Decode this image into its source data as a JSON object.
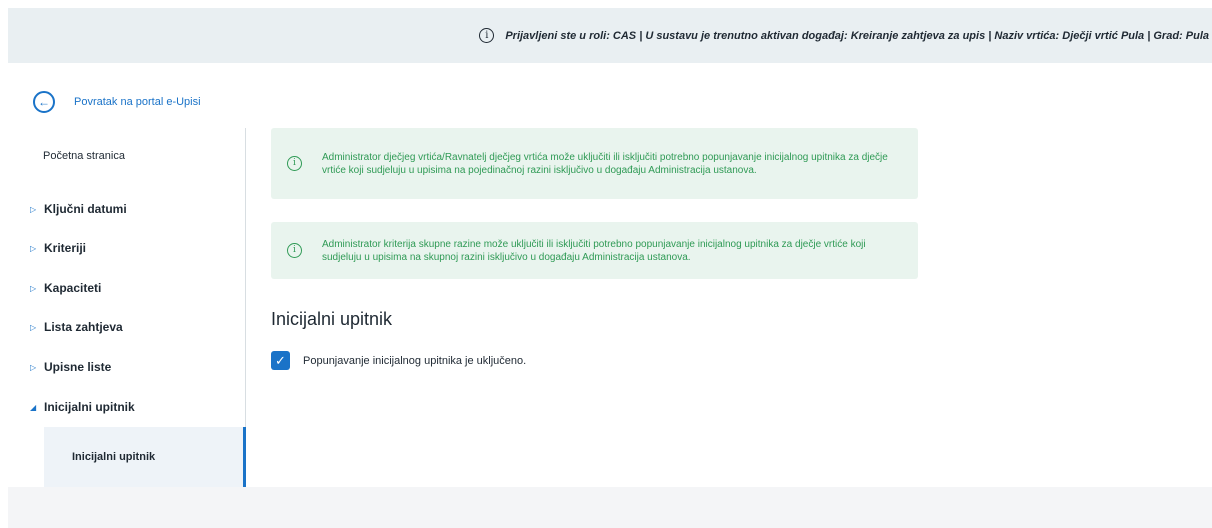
{
  "header": {
    "status_text": "Prijavljeni ste u roli: CAS | U sustavu je trenutno aktivan događaj: Kreiranje zahtjeva za upis | Naziv vrtića: Dječji vrtić Pula | Grad: Pula",
    "info_icon": "info-icon"
  },
  "back_link": {
    "label": "Povratak na portal e-Upisi",
    "icon": "arrow-left-icon"
  },
  "sidebar": {
    "home": "Početna stranica",
    "items": [
      {
        "label": "Ključni datumi",
        "expanded": false
      },
      {
        "label": "Kriteriji",
        "expanded": false
      },
      {
        "label": "Kapaciteti",
        "expanded": false
      },
      {
        "label": "Lista zahtjeva",
        "expanded": false
      },
      {
        "label": "Upisne liste",
        "expanded": false
      },
      {
        "label": "Inicijalni upitnik",
        "expanded": true
      }
    ],
    "sub_item": "Inicijalni upitnik"
  },
  "notices": [
    {
      "text": "Administrator dječjeg vrtića/Ravnatelj dječjeg vrtića može uključiti ili isključiti potrebno popunjavanje inicijalnog upitnika za dječje vrtiće koji sudjeluju u upisima na pojedinačnoj razini isključivo u događaju Administracija ustanova."
    },
    {
      "text": "Administrator kriterija skupne razine može uključiti ili isključiti potrebno popunjavanje inicijalnog upitnika za dječje vrtiće koji sudjeluju u upisima na skupnoj razini isključivo u događaju Administracija ustanova."
    }
  ],
  "main": {
    "title": "Inicijalni upitnik",
    "checkbox_label": "Popunjavanje inicijalnog upitnika je uključeno.",
    "checkbox_checked": true
  },
  "colors": {
    "accent": "#1a73c8",
    "notice_bg": "#e9f4ee",
    "notice_text": "#2f9a55",
    "header_bg": "#e9eff2"
  }
}
